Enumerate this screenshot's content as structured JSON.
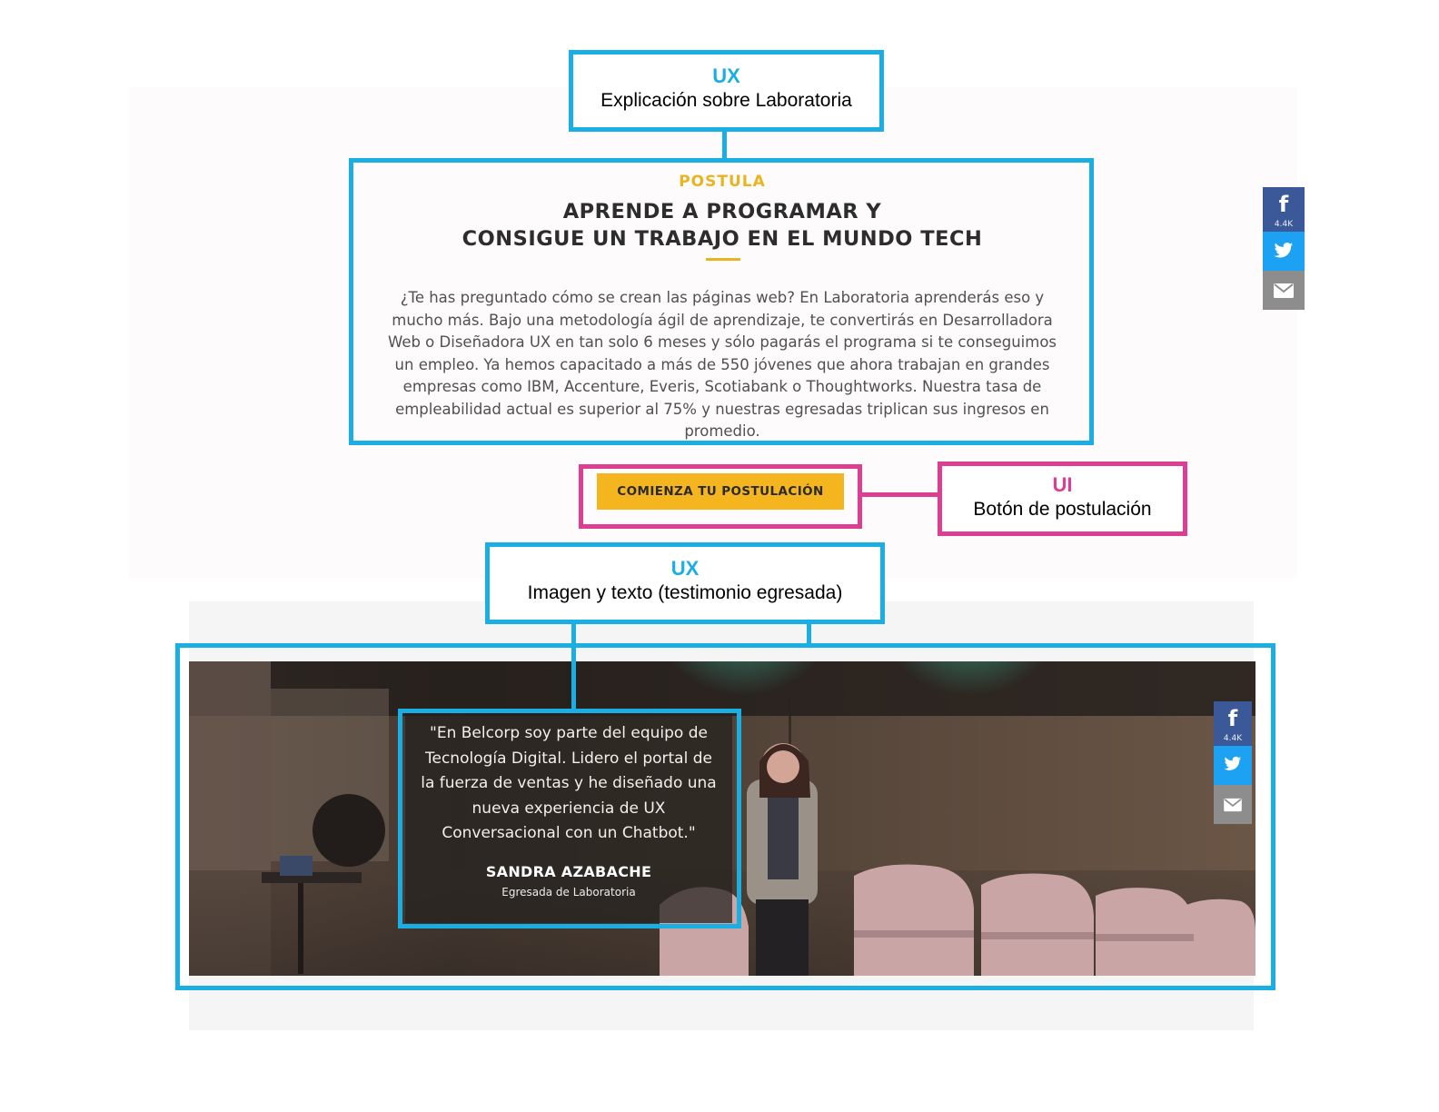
{
  "annotations": {
    "ux_explanation": {
      "tag": "UX",
      "description": "Explicación sobre Laboratoria"
    },
    "ui_button": {
      "tag": "UI",
      "description": "Botón de postulación"
    },
    "ux_testimonial": {
      "tag": "UX",
      "description": "Imagen y texto (testimonio egresada)"
    }
  },
  "hero": {
    "eyebrow": "POSTULA",
    "headline_line1": "APRENDE A PROGRAMAR Y",
    "headline_line2": "CONSIGUE UN TRABAJO EN EL MUNDO TECH",
    "body": "¿Te has preguntado cómo se crean las páginas web? En Laboratoria aprenderás eso y mucho más. Bajo una metodología ágil de aprendizaje, te convertirás en Desarrolladora Web o Diseñadora UX en tan solo 6 meses y sólo pagarás el programa si te conseguimos un empleo. Ya hemos capacitado a más de 550 jóvenes que ahora trabajan en grandes empresas como IBM, Accenture, Everis, Scotiabank o Thoughtworks. Nuestra tasa de empleabilidad actual es superior al 75% y nuestras egresadas triplican sus ingresos en promedio."
  },
  "cta": {
    "label": "COMIENZA TU POSTULACIÓN"
  },
  "share": {
    "facebook_glyph": "f",
    "facebook_count": "4.4K",
    "icons": [
      "facebook-icon",
      "twitter-icon",
      "email-icon"
    ]
  },
  "testimonial": {
    "quote": "\"En Belcorp soy parte del equipo de Tecnología Digital. Lidero el portal de la fuerza de ventas y he diseñado una nueva experiencia de UX Conversacional con un Chatbot.\"",
    "name": "SANDRA AZABACHE",
    "role": "Egresada de Laboratoria"
  },
  "colors": {
    "ux_annotation": "#1aaee3",
    "ui_annotation": "#dc3f92",
    "brand_yellow": "#f4b51f",
    "facebook": "#3b5998",
    "twitter": "#1da1f2",
    "email": "#8d8d8d"
  }
}
